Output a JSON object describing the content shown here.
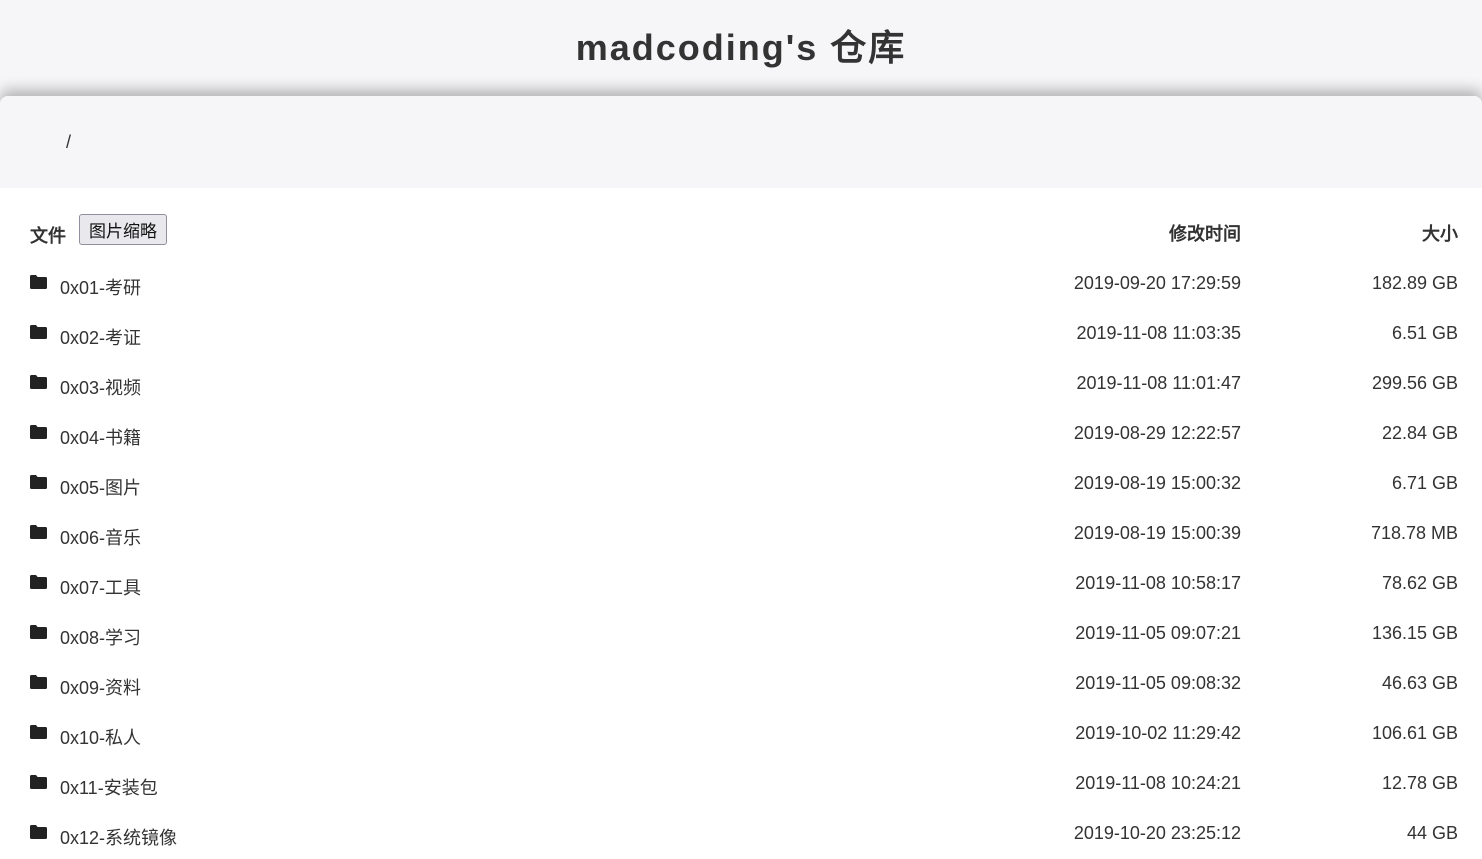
{
  "site": {
    "title": "madcoding's 仓库"
  },
  "breadcrumb": {
    "path": "/"
  },
  "list_header": {
    "file_label": "文件",
    "thumbnail_button": "图片缩略",
    "modified_label": "修改时间",
    "size_label": "大小"
  },
  "icons": {
    "folder": "folder-icon"
  },
  "files": [
    {
      "name": "0x01-考研",
      "modified": "2019-09-20 17:29:59",
      "size": "182.89 GB"
    },
    {
      "name": "0x02-考证",
      "modified": "2019-11-08 11:03:35",
      "size": "6.51 GB"
    },
    {
      "name": "0x03-视频",
      "modified": "2019-11-08 11:01:47",
      "size": "299.56 GB"
    },
    {
      "name": "0x04-书籍",
      "modified": "2019-08-29 12:22:57",
      "size": "22.84 GB"
    },
    {
      "name": "0x05-图片",
      "modified": "2019-08-19 15:00:32",
      "size": "6.71 GB"
    },
    {
      "name": "0x06-音乐",
      "modified": "2019-08-19 15:00:39",
      "size": "718.78 MB"
    },
    {
      "name": "0x07-工具",
      "modified": "2019-11-08 10:58:17",
      "size": "78.62 GB"
    },
    {
      "name": "0x08-学习",
      "modified": "2019-11-05 09:07:21",
      "size": "136.15 GB"
    },
    {
      "name": "0x09-资料",
      "modified": "2019-11-05 09:08:32",
      "size": "46.63 GB"
    },
    {
      "name": "0x10-私人",
      "modified": "2019-10-02 11:29:42",
      "size": "106.61 GB"
    },
    {
      "name": "0x11-安装包",
      "modified": "2019-11-08 10:24:21",
      "size": "12.78 GB"
    },
    {
      "name": "0x12-系统镜像",
      "modified": "2019-10-20 23:25:12",
      "size": "44 GB"
    }
  ]
}
